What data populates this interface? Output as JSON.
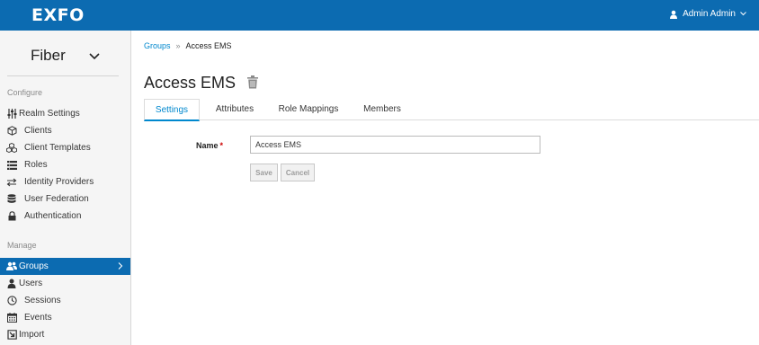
{
  "header": {
    "logo_text": "EXFO",
    "user_label": "Admin Admin",
    "brand_color": "#0c6bb1"
  },
  "sidebar": {
    "realm_name": "Fiber",
    "configure_label": "Configure",
    "configure_items": [
      {
        "label": "Realm Settings",
        "icon": "sliders-icon"
      },
      {
        "label": "Clients",
        "icon": "cube-icon"
      },
      {
        "label": "Client Templates",
        "icon": "cubes-icon"
      },
      {
        "label": "Roles",
        "icon": "list-icon"
      },
      {
        "label": "Identity Providers",
        "icon": "exchange-icon"
      },
      {
        "label": "User Federation",
        "icon": "database-icon"
      },
      {
        "label": "Authentication",
        "icon": "lock-icon"
      }
    ],
    "manage_label": "Manage",
    "manage_items": [
      {
        "label": "Groups",
        "icon": "users-icon",
        "active": true
      },
      {
        "label": "Users",
        "icon": "user-icon"
      },
      {
        "label": "Sessions",
        "icon": "clock-icon"
      },
      {
        "label": "Events",
        "icon": "calendar-icon"
      },
      {
        "label": "Import",
        "icon": "import-icon"
      }
    ]
  },
  "breadcrumb": {
    "parent": "Groups",
    "separator": "»",
    "current": "Access EMS"
  },
  "page": {
    "title": "Access EMS"
  },
  "tabs": [
    "Settings",
    "Attributes",
    "Role Mappings",
    "Members"
  ],
  "active_tab": "Settings",
  "form": {
    "name_label": "Name",
    "required_mark": "*",
    "name_value": "Access EMS",
    "save_label": "Save",
    "cancel_label": "Cancel"
  }
}
